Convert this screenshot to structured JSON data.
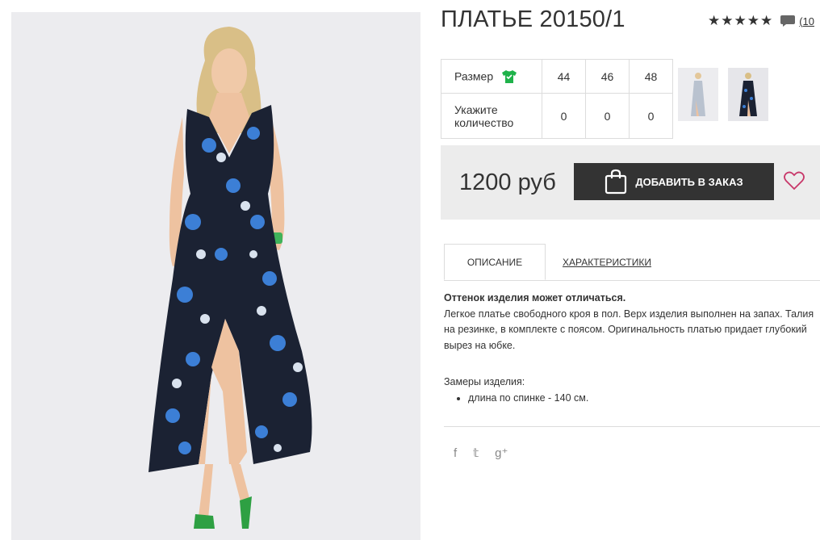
{
  "product": {
    "title": "ПЛАТЬЕ 20150/1",
    "stars": "★★★★★",
    "reviews_link": "(10",
    "price": "1200 руб",
    "add_to_order": "ДОБАВИТЬ В ЗАКАЗ"
  },
  "size_table": {
    "size_label": "Размер",
    "sizes": [
      "44",
      "46",
      "48"
    ],
    "qty_label_line1": "Укажите",
    "qty_label_line2": "количество",
    "quantities": [
      "0",
      "0",
      "0"
    ]
  },
  "tabs": [
    {
      "label": "ОПИСАНИЕ",
      "active": true
    },
    {
      "label": "ХАРАКТЕРИСТИКИ",
      "active": false
    }
  ],
  "description": {
    "note": "Оттенок изделия может отличаться.",
    "text": "Легкое платье свободного кроя в пол. Верх изделия выполнен на запах. Талия на резинке, в комплекте с поясом. Оригинальность платью придает глубокий вырез на юбке.",
    "measurements_title": "Замеры изделия:",
    "measurements": [
      "длина по спинке - 140 см."
    ]
  },
  "social": {
    "facebook": "f",
    "twitter": "𝕥",
    "google_plus": "g⁺"
  },
  "colors": {
    "dark_button": "#333333",
    "tshirt_icon": "#1fb24a",
    "heart": "#c8386a",
    "price_box": "#ececec",
    "dress": "#1b2233",
    "flower_blue": "#3c7fd6",
    "sandals": "#2ea043"
  },
  "icons": [
    "comment-icon",
    "tshirt-icon",
    "bag-icon",
    "heart-icon",
    "facebook-icon",
    "twitter-icon",
    "google-plus-icon"
  ]
}
